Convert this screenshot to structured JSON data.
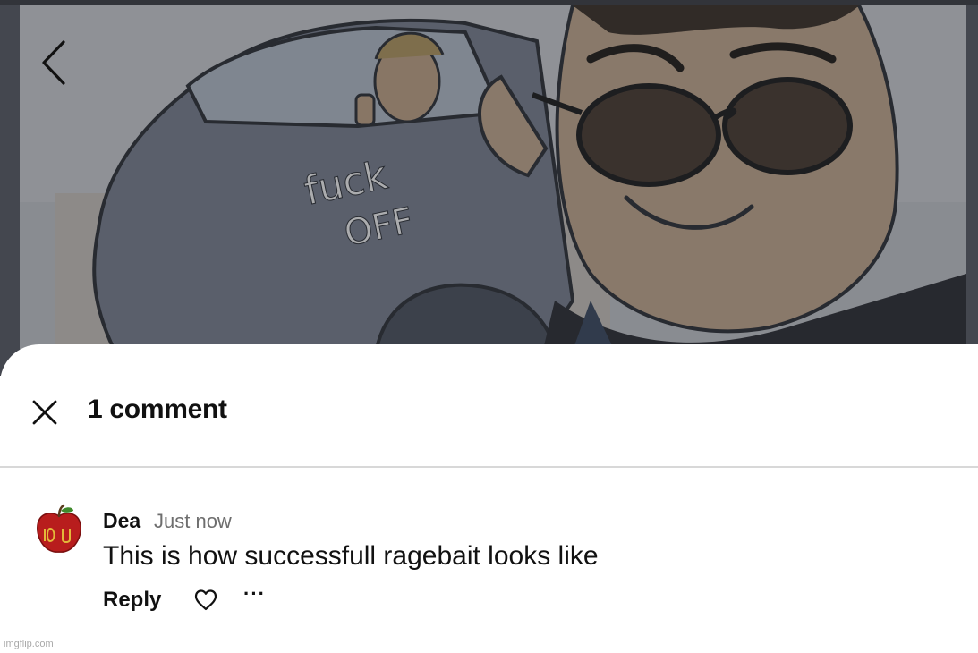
{
  "navigation": {
    "back_icon": "chevron-left-icon"
  },
  "hero": {
    "car_text_line1": "fuck",
    "car_text_line2": "off"
  },
  "comments_sheet": {
    "title": "1 comment",
    "close_icon": "close-icon",
    "comments": [
      {
        "author": "Dea",
        "time": "Just now",
        "text": "This is how successfull ragebait looks like",
        "reply_label": "Reply",
        "like_icon": "heart-outline-icon",
        "more_icon": "ellipsis-icon",
        "more_label": "···"
      }
    ]
  },
  "watermark": "imgflip.com",
  "colors": {
    "sheet_background": "#ffffff",
    "text_primary": "#111111",
    "text_secondary": "#6e6e6e",
    "divider": "#d8d8d8"
  }
}
